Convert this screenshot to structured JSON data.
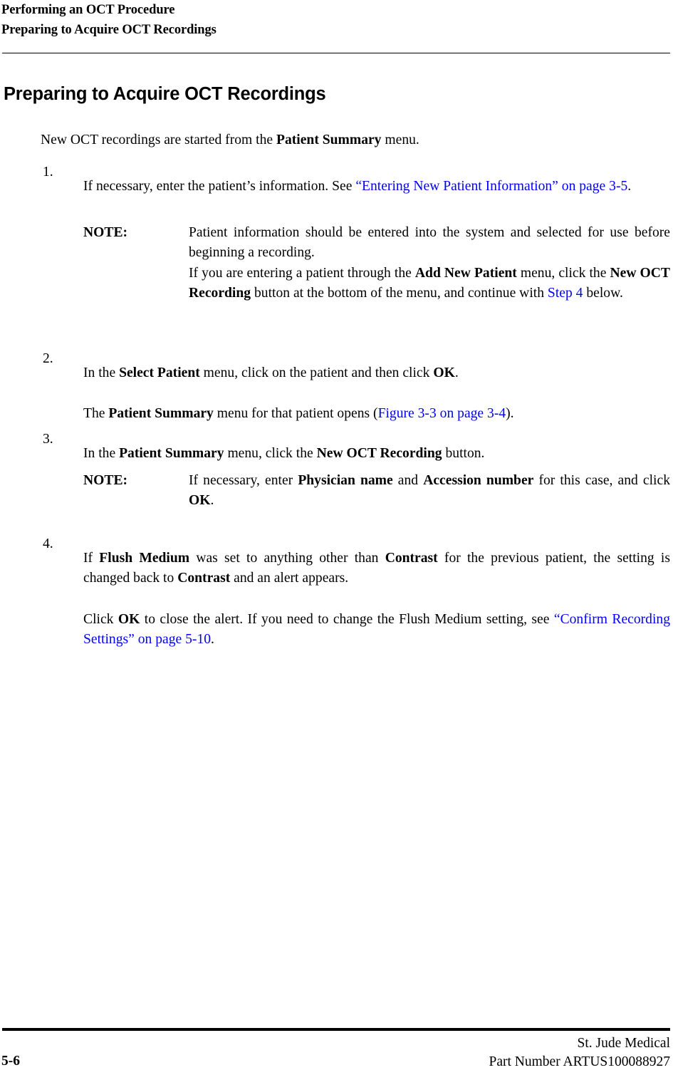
{
  "header": {
    "line1": "Performing an OCT Procedure",
    "line2": "Preparing to Acquire OCT Recordings"
  },
  "section": {
    "heading": "Preparing to Acquire OCT Recordings"
  },
  "intro": {
    "before": "New OCT recordings are started from the ",
    "bold": "Patient Summary",
    "after": " menu."
  },
  "steps": [
    {
      "number": "1.",
      "t1": "If necessary, enter the patient’s information. See ",
      "link": "“Entering New Patient Information” on page 3-5",
      "t2": "."
    },
    {
      "number": "2.",
      "t1": "In the ",
      "b1": "Select Patient",
      "t2": " menu, click on the patient and then click ",
      "b2": "OK",
      "t3": "."
    },
    {
      "number": "3.",
      "t1": "In the ",
      "b1": "Patient Summary",
      "t2": " menu, click the ",
      "b2": "New OCT Recording",
      "t3": " button."
    },
    {
      "number": "4.",
      "t1": "If ",
      "b1": "Flush Medium",
      "t2": " was set to anything other than ",
      "b2": "Contrast",
      "t3": " for the previous patient, the setting is changed back to ",
      "b3": "Contrast",
      "t4": " and an alert appears."
    }
  ],
  "step2_result": {
    "t1": "The ",
    "b1": "Patient Summary",
    "t2": " menu for that patient opens (",
    "link": "Figure 3-3 on page 3-4",
    "t3": ")."
  },
  "step4_result": {
    "t1": "Click ",
    "b1": "OK",
    "t2": " to close the alert. If you need to change the Flush Medium setting, see ",
    "link": "“Confirm Recording Settings” on page 5-10",
    "t3": "."
  },
  "notes": [
    {
      "label": "NOTE:",
      "line1": "Patient information should be entered into the system and selected for use before beginning a recording.",
      "p2_t1": "If you are entering a patient through the ",
      "p2_b1": "Add New Patient",
      "p2_t2": " menu, click the ",
      "p2_b2": "New OCT Recording",
      "p2_t3": " button at the bottom of the menu, and continue with ",
      "p2_link": "Step 4",
      "p2_t4": " below."
    },
    {
      "label": "NOTE:",
      "t1": "If necessary, enter ",
      "b1": "Physician name",
      "t2": " and ",
      "b2": "Accession number",
      "t3": " for this case, and click ",
      "b3": "OK",
      "t4": "."
    }
  ],
  "footer": {
    "page_number": "5-6",
    "company": "St. Jude Medical",
    "part_number": "Part Number ARTUS100088927"
  },
  "colors": {
    "link": "#0000FF",
    "text": "#000000",
    "rule": "#000000"
  }
}
